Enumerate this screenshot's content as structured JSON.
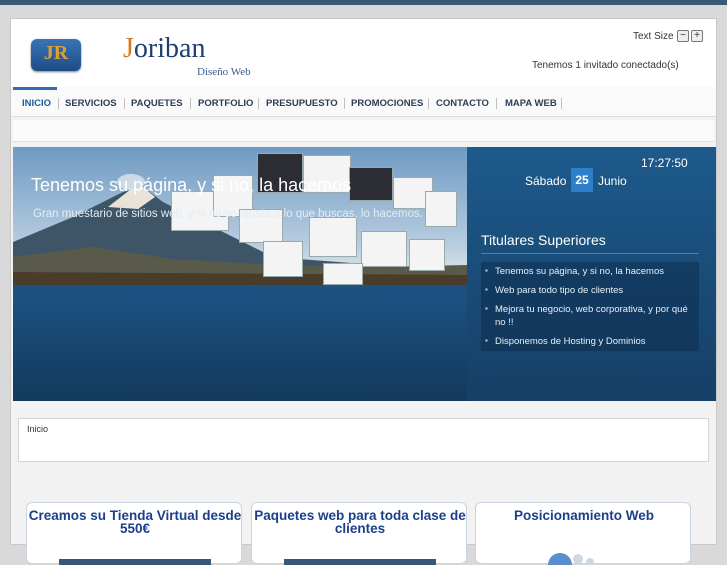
{
  "header": {
    "logo_letters": "JR",
    "brand_first": "J",
    "brand_rest": "oriban",
    "tagline": "Diseño Web",
    "text_size_label": "Text Size",
    "text_size_decrease": "−",
    "text_size_increase": "+",
    "online_status": "Tenemos 1 invitado conectado(s)"
  },
  "nav": {
    "items": [
      {
        "label": "INICIO"
      },
      {
        "label": "SERVICIOS"
      },
      {
        "label": "PAQUETES"
      },
      {
        "label": "PORTFOLIO"
      },
      {
        "label": "PRESUPUESTO"
      },
      {
        "label": "PROMOCIONES"
      },
      {
        "label": "CONTACTO"
      },
      {
        "label": "MAPA WEB"
      }
    ],
    "active_index": 0
  },
  "banner": {
    "title": "Tenemos su página, y si no, la hacemos",
    "subtitle": "Gran muestario de sitios web, y si no se ajusta a lo que buscas, lo hacemos."
  },
  "sidebar": {
    "time": "17:27:50",
    "day_name": "Sábado",
    "day_number": "25",
    "month": "Junio",
    "title": "Titulares Superiores",
    "headlines": [
      {
        "text": "Tenemos su página, y si no, la hacemos"
      },
      {
        "text": "Web para todo tipo de clientes"
      },
      {
        "text": "Mejora tu negocio, web corporativa, y por qué no !!"
      },
      {
        "text": "Disponemos de Hosting y Dominios"
      }
    ]
  },
  "breadcrumb": {
    "text": "Inicio"
  },
  "cards": [
    {
      "title": "Creamos su Tienda Virtual desde 550€"
    },
    {
      "title": "Paquetes web para toda clase de clientes"
    },
    {
      "title": "Posicionamiento Web"
    }
  ],
  "colors": {
    "nav_text": "#2a3f57",
    "accent": "#2f6db0",
    "banner_dark": "#173d5e",
    "card_title": "#1b3f8a"
  }
}
